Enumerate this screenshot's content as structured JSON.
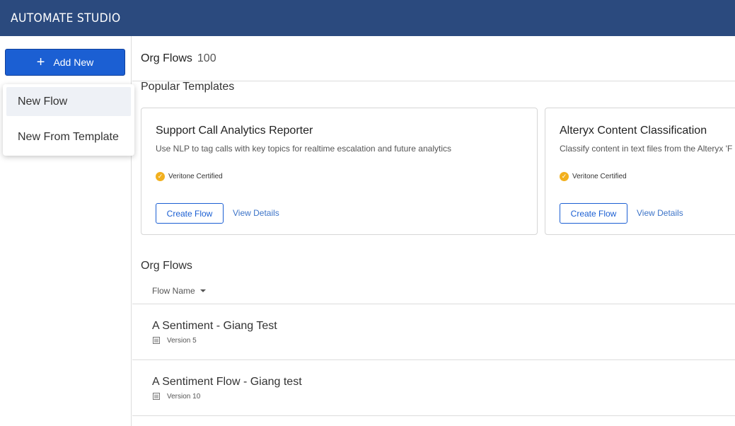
{
  "app": {
    "title": "AUTOMATE STUDIO"
  },
  "sidebar": {
    "add_new_label": "Add New",
    "menu": [
      {
        "label": "New Flow",
        "active": true
      },
      {
        "label": "New From Template",
        "active": false
      }
    ]
  },
  "header": {
    "title": "Org Flows",
    "count": "100"
  },
  "templates": {
    "section_title": "Popular Templates",
    "cards": [
      {
        "title": "Support Call Analytics Reporter",
        "description": "Use NLP to tag calls with key topics for realtime escalation and future analytics",
        "certification": "Veritone Certified",
        "create_label": "Create Flow",
        "view_label": "View Details"
      },
      {
        "title": "Alteryx Content Classification",
        "description": "Classify content in text files from the Alteryx 'F",
        "certification": "Veritone Certified",
        "create_label": "Create Flow",
        "view_label": "View Details"
      }
    ]
  },
  "flows": {
    "section_title": "Org Flows",
    "column_header": "Flow Name",
    "rows": [
      {
        "name": "A Sentiment - Giang Test",
        "version": "Version 5"
      },
      {
        "name": "A Sentiment Flow - Giang test",
        "version": "Version 10"
      }
    ]
  },
  "colors": {
    "topbar": "#2b4a7e",
    "primary": "#1b5fd3",
    "badge": "#f2b01e",
    "link": "#3d74c8"
  },
  "icons": {
    "add": "plus-icon",
    "certified": "check-badge-icon",
    "version": "flow-version-icon",
    "sort": "caret-down-icon"
  }
}
